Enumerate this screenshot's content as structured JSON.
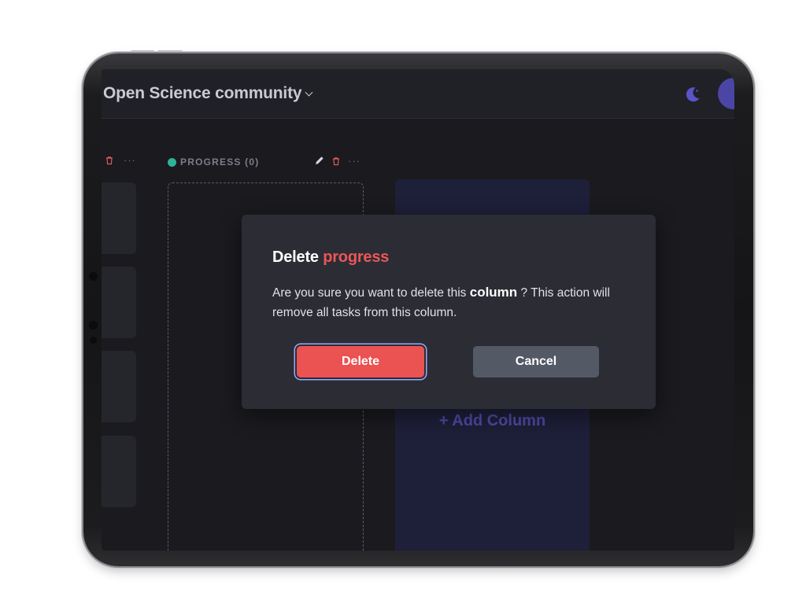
{
  "header": {
    "board_title": "Open Science community"
  },
  "board": {
    "column": {
      "title": "PROGRESS (0)"
    },
    "add_column_label": "+ Add Column"
  },
  "modal": {
    "title_prefix": "Delete",
    "title_accent": "progress",
    "body_part1": "Are you sure you want to delete this ",
    "body_bold": "column",
    "body_part2": " ?  This action will remove all tasks from this column.",
    "delete_label": "Delete",
    "cancel_label": "Cancel"
  },
  "colors": {
    "accent_red": "#eb5252",
    "status_teal": "#2db39a",
    "brand_purple": "#4d49a4"
  }
}
